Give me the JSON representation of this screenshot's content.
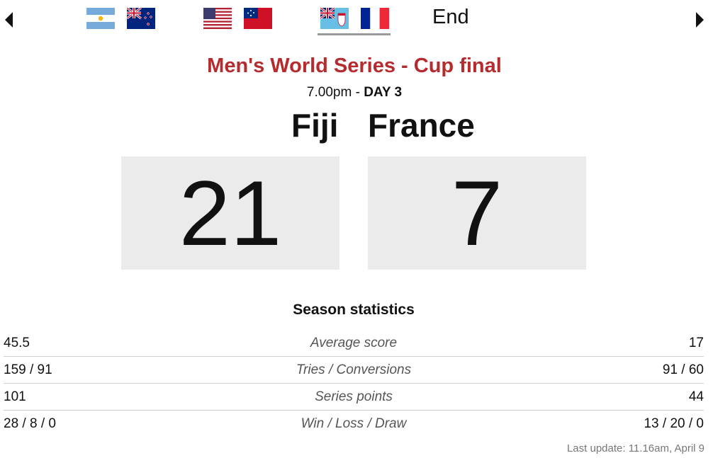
{
  "fixtures_bar": {
    "prev_icon": "caret-left-icon",
    "next_icon": "caret-right-icon",
    "matches": [
      {
        "flags": [
          "argentina-flag-icon",
          "new-zealand-flag-icon"
        ]
      },
      {
        "flags": [
          "usa-flag-icon",
          "samoa-flag-icon"
        ]
      },
      {
        "flags": [
          "fiji-flag-icon",
          "france-flag-icon"
        ],
        "selected": true
      }
    ],
    "status": "End"
  },
  "match": {
    "title": "Men's World Series - Cup final",
    "time": "7.00pm",
    "separator": " - ",
    "day": "DAY 3",
    "home": {
      "name": "Fiji",
      "score": "21"
    },
    "away": {
      "name": "France",
      "score": "7"
    }
  },
  "stats": {
    "heading": "Season statistics",
    "rows": [
      {
        "home": "45.5",
        "label": "Average score",
        "away": "17"
      },
      {
        "home": "159 / 91",
        "label": "Tries / Conversions",
        "away": "91 / 60"
      },
      {
        "home": "101",
        "label": "Series points",
        "away": "44"
      },
      {
        "home": "28 / 8 / 0",
        "label": "Win / Loss / Draw",
        "away": "13 / 20 / 0"
      }
    ]
  },
  "last_update": "Last update: 11.16am, April 9",
  "colors": {
    "title": "#b52b2e",
    "score_bg": "#ebebeb",
    "divider": "#cfcfcf"
  }
}
